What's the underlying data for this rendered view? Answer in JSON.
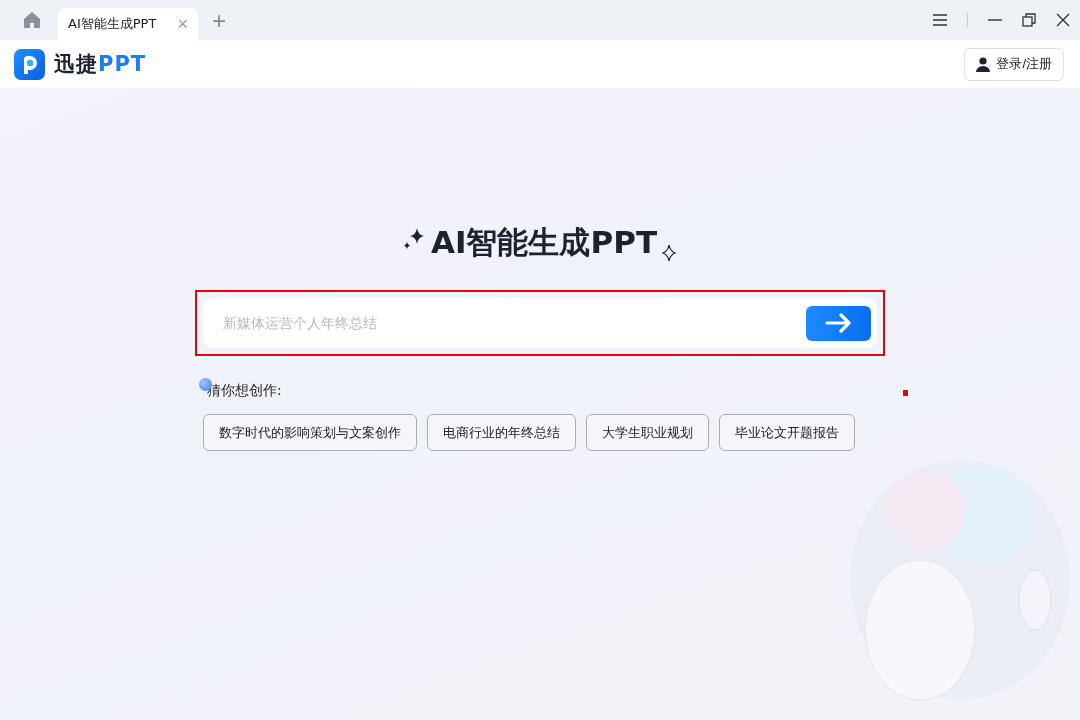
{
  "tabs": [
    {
      "label": "AI智能生成PPT",
      "selected": true,
      "close": "×"
    }
  ],
  "new_tab": "+",
  "logo": {
    "text_dark": "迅捷",
    "text_brand": "PPT"
  },
  "login_button": "登录/注册",
  "headline": "AI智能生成PPT",
  "prompt": {
    "placeholder": "新媒体运营个人年终总结",
    "highlighted": true
  },
  "suggestions": {
    "label": "猜你想创作:",
    "items": [
      "数字时代的影响策划与文案创作",
      "电商行业的年终总结",
      "大学生职业规划",
      "毕业论文开题报告"
    ]
  }
}
